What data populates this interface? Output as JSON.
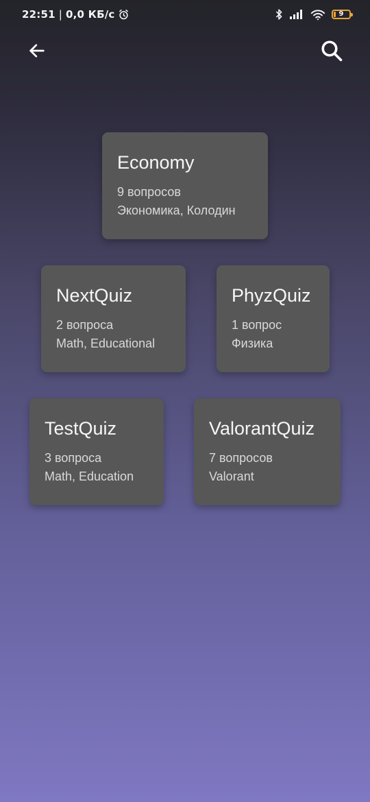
{
  "status_bar": {
    "time": "22:51",
    "separator": "|",
    "network_speed": "0,0 КБ/с",
    "battery_level": "9",
    "icons": [
      "alarm-icon",
      "bluetooth-icon",
      "signal-icon",
      "wifi-icon",
      "battery-icon"
    ],
    "battery_color": "#e8a43a"
  },
  "app_bar": {
    "back_icon": "arrow-back-icon",
    "search_icon": "search-icon"
  },
  "colors": {
    "card_background": "#575757",
    "gradient_top": "#232329",
    "gradient_bottom": "#7f78c2"
  },
  "quizzes": [
    {
      "title": "Economy",
      "questions": "9 вопросов",
      "tags": "Экономика, Колодин"
    },
    {
      "title": "NextQuiz",
      "questions": "2 вопроса",
      "tags": "Math, Educational"
    },
    {
      "title": "PhyzQuiz",
      "questions": "1 вопрос",
      "tags": "Физика"
    },
    {
      "title": "TestQuiz",
      "questions": "3 вопроса",
      "tags": "Math, Education"
    },
    {
      "title": "ValorantQuiz",
      "questions": "7 вопросов",
      "tags": "Valorant"
    }
  ]
}
